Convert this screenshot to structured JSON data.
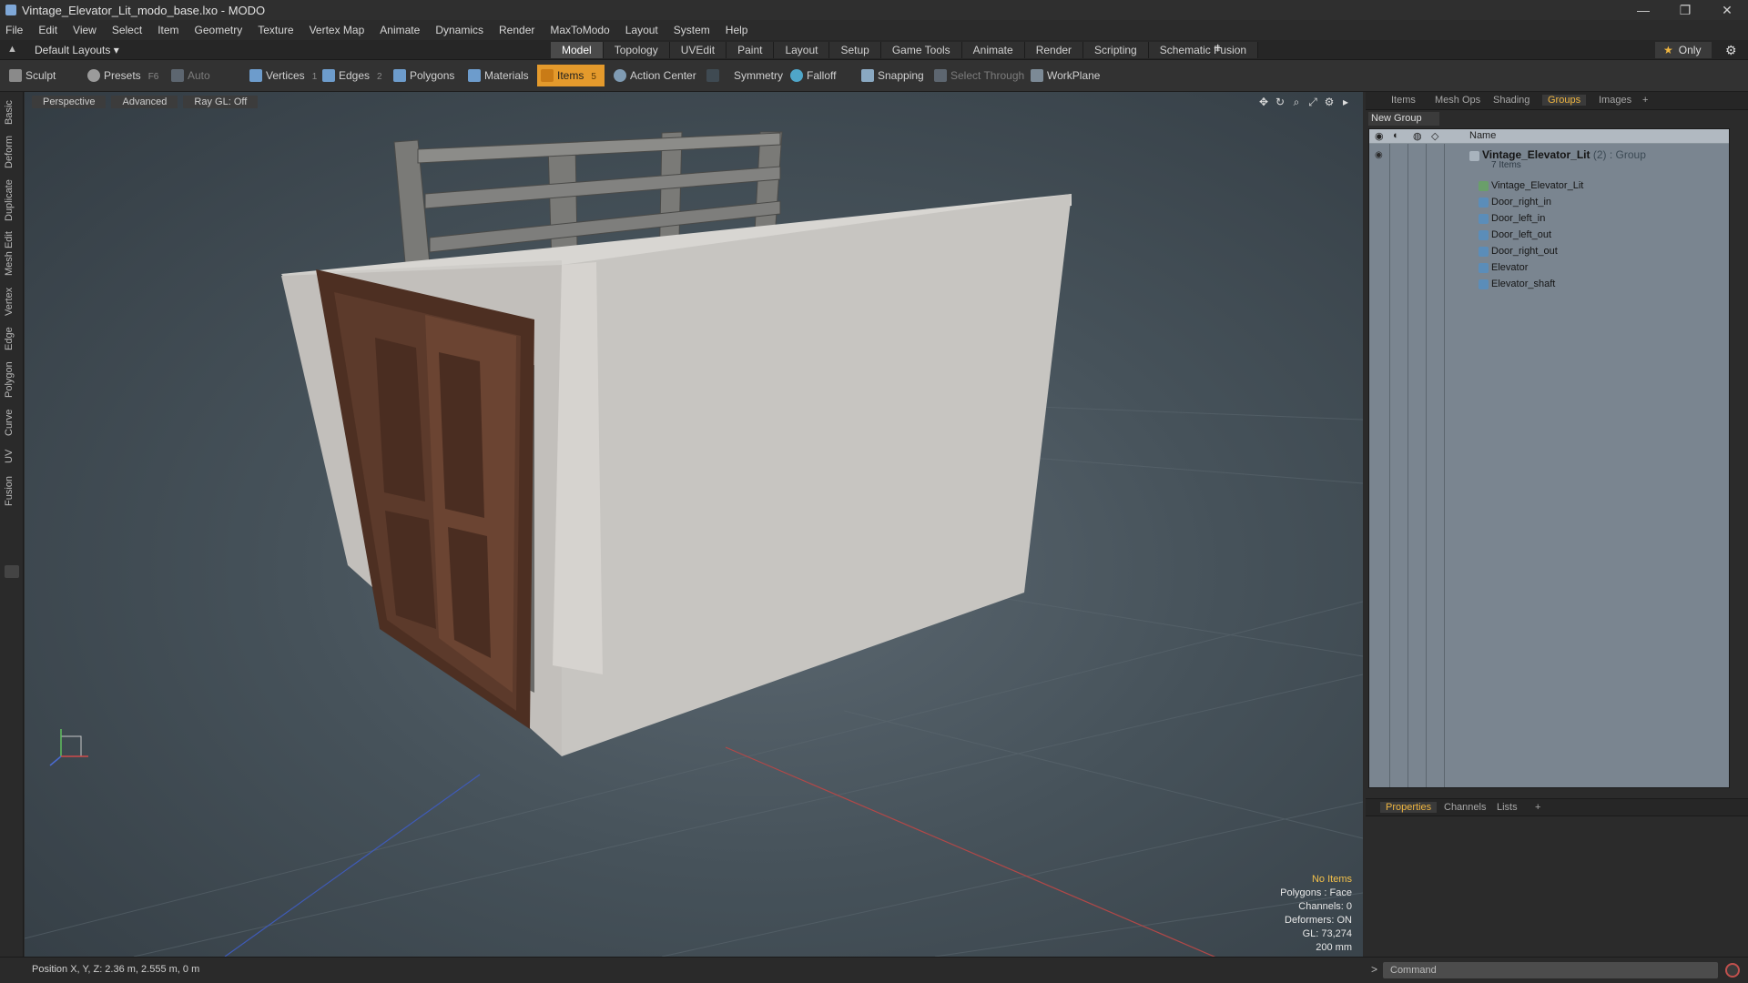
{
  "window": {
    "title": "Vintage_Elevator_Lit_modo_base.lxo - MODO",
    "controls": [
      "—",
      "❐",
      "✕"
    ]
  },
  "menu": [
    "File",
    "Edit",
    "View",
    "Select",
    "Item",
    "Geometry",
    "Texture",
    "Vertex Map",
    "Animate",
    "Dynamics",
    "Render",
    "MaxToModo",
    "Layout",
    "System",
    "Help"
  ],
  "layout_bar": {
    "layouts_label": "Default Layouts ▾",
    "mode_tabs": [
      "Model",
      "Topology",
      "UVEdit",
      "Paint",
      "Layout",
      "Setup",
      "Game Tools",
      "Animate",
      "Render",
      "Scripting",
      "Schematic Fusion"
    ],
    "active_tab": "Model",
    "plus": "+",
    "only_label": "Only",
    "star": "★"
  },
  "toolbar": {
    "sculpt": "Sculpt",
    "presets": "Presets",
    "presets_key": "F6",
    "auto_select": "Auto Select",
    "vertices": "Vertices",
    "vertices_key": "1",
    "edges": "Edges",
    "edges_key": "2",
    "polygons": "Polygons",
    "materials": "Materials",
    "items": "Items",
    "items_key": "5",
    "action_center": "Action Center",
    "symmetry": "Symmetry",
    "falloff": "Falloff",
    "snapping": "Snapping",
    "select_through": "Select Through",
    "workplane": "WorkPlane"
  },
  "left_tabs": [
    "Basic",
    "Deform",
    "Duplicate",
    "Mesh Edit",
    "Vertex",
    "Edge",
    "Polygon",
    "Curve",
    "UV",
    "Fusion"
  ],
  "viewport": {
    "view_mode": "Perspective",
    "shading": "Advanced",
    "raygl": "Ray GL: Off",
    "stats": {
      "selection": "No Items",
      "polygons": "Polygons : Face",
      "channels": "Channels: 0",
      "deformers": "Deformers: ON",
      "gl": "GL: 73,274",
      "scale": "200 mm"
    }
  },
  "right_panel": {
    "tabs": [
      "Items",
      "Mesh Ops",
      "Shading",
      "Groups",
      "Images",
      "+"
    ],
    "active_tab": "Groups",
    "new_group": "New Group",
    "column_name": "Name",
    "group": {
      "name": "Vintage_Elevator_Lit",
      "count": "(2)",
      "type": ": Group",
      "items_label": "7 Items"
    },
    "items": [
      "Vintage_Elevator_Lit",
      "Door_right_in",
      "Door_left_in",
      "Door_left_out",
      "Door_right_out",
      "Elevator",
      "Elevator_shaft"
    ],
    "bottom_tabs": [
      "Properties",
      "Channels",
      "Lists",
      "+"
    ],
    "bottom_active": "Properties"
  },
  "status": {
    "position": "Position X, Y, Z:  2.36 m, 2.555 m, 0 m",
    "command_prompt": ">",
    "command_placeholder": "Command"
  },
  "colors": {
    "accent": "#e49a2c",
    "active_tab_text": "#f0b640",
    "stats_highlight": "#f3c04a",
    "tree_bg": "#7a8590"
  }
}
